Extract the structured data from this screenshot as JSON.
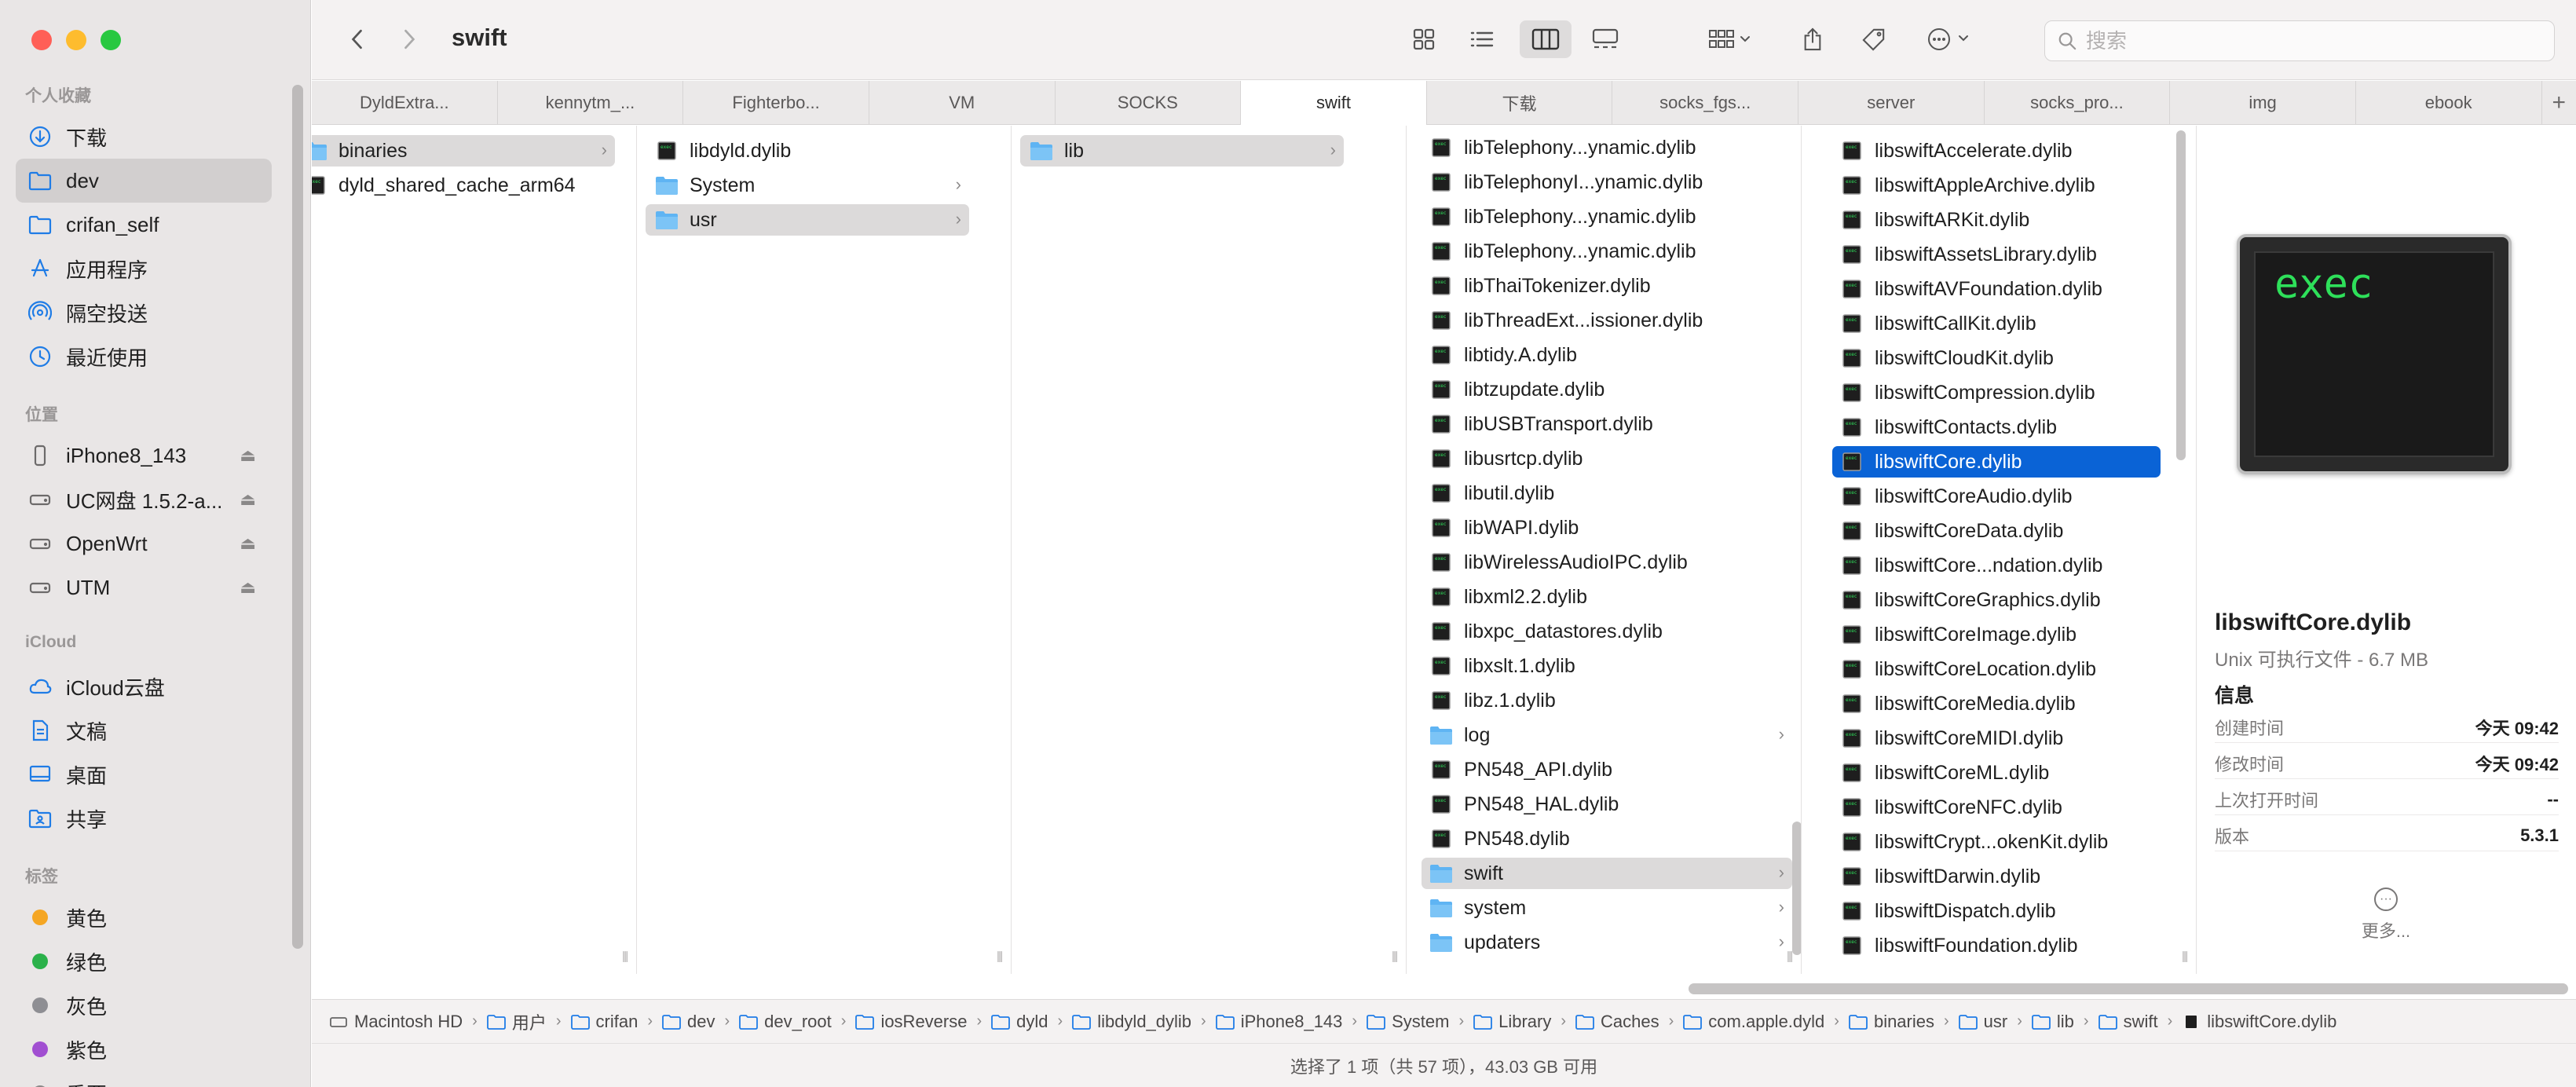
{
  "window": {
    "title": "swift"
  },
  "search": {
    "placeholder": "搜索"
  },
  "sidebar": {
    "favorites_title": "个人收藏",
    "favorites": [
      {
        "label": "下载",
        "icon": "download-icon"
      },
      {
        "label": "dev",
        "icon": "folder-icon",
        "selected": true
      },
      {
        "label": "crifan_self",
        "icon": "folder-icon"
      },
      {
        "label": "应用程序",
        "icon": "apps-icon"
      },
      {
        "label": "隔空投送",
        "icon": "airdrop-icon"
      },
      {
        "label": "最近使用",
        "icon": "clock-icon"
      }
    ],
    "locations_title": "位置",
    "locations": [
      {
        "label": "iPhone8_143",
        "icon": "iphone-icon"
      },
      {
        "label": "UC网盘 1.5.2-a...",
        "icon": "drive-icon"
      },
      {
        "label": "OpenWrt",
        "icon": "drive-icon"
      },
      {
        "label": "UTM",
        "icon": "drive-icon"
      }
    ],
    "icloud_title": "iCloud",
    "icloud": [
      {
        "label": "iCloud云盘",
        "icon": "cloud-icon"
      },
      {
        "label": "文稿",
        "icon": "document-icon"
      },
      {
        "label": "桌面",
        "icon": "desktop-icon"
      },
      {
        "label": "共享",
        "icon": "shared-folder-icon"
      }
    ],
    "tags_title": "标签",
    "tags": [
      {
        "label": "黄色",
        "color": "#f5a623"
      },
      {
        "label": "绿色",
        "color": "#2bb14a"
      },
      {
        "label": "灰色",
        "color": "#8e8e93"
      },
      {
        "label": "紫色",
        "color": "#a14fd1"
      },
      {
        "label": "重要",
        "color": "#ffffff"
      }
    ]
  },
  "tabs": [
    "DyldExtra...",
    "kennytm_...",
    "Fighterbo...",
    "VM",
    "SOCKS",
    "swift",
    "下载",
    "socks_fgs...",
    "server",
    "socks_pro...",
    "img",
    "ebook"
  ],
  "active_tab": "swift",
  "columns": {
    "col1": [
      {
        "name": "binaries",
        "type": "folder",
        "selected": "gray"
      },
      {
        "name": "dyld_shared_cache_arm64",
        "type": "exec"
      }
    ],
    "col2": [
      {
        "name": "libdyld.dylib",
        "type": "exec"
      },
      {
        "name": "System",
        "type": "folder"
      },
      {
        "name": "usr",
        "type": "folder",
        "selected": "gray"
      }
    ],
    "col3": [
      {
        "name": "lib",
        "type": "folder",
        "selected": "gray"
      }
    ],
    "col4": [
      {
        "name": "libTelephony...ynamic.dylib",
        "type": "exec"
      },
      {
        "name": "libTelephonyI...ynamic.dylib",
        "type": "exec"
      },
      {
        "name": "libTelephony...ynamic.dylib",
        "type": "exec"
      },
      {
        "name": "libTelephony...ynamic.dylib",
        "type": "exec"
      },
      {
        "name": "libThaiTokenizer.dylib",
        "type": "exec"
      },
      {
        "name": "libThreadExt...issioner.dylib",
        "type": "exec"
      },
      {
        "name": "libtidy.A.dylib",
        "type": "exec"
      },
      {
        "name": "libtzupdate.dylib",
        "type": "exec"
      },
      {
        "name": "libUSBTransport.dylib",
        "type": "exec"
      },
      {
        "name": "libusrtcp.dylib",
        "type": "exec"
      },
      {
        "name": "libutil.dylib",
        "type": "exec"
      },
      {
        "name": "libWAPI.dylib",
        "type": "exec"
      },
      {
        "name": "libWirelessAudioIPC.dylib",
        "type": "exec"
      },
      {
        "name": "libxml2.2.dylib",
        "type": "exec"
      },
      {
        "name": "libxpc_datastores.dylib",
        "type": "exec"
      },
      {
        "name": "libxslt.1.dylib",
        "type": "exec"
      },
      {
        "name": "libz.1.dylib",
        "type": "exec"
      },
      {
        "name": "log",
        "type": "folder"
      },
      {
        "name": "PN548_API.dylib",
        "type": "exec"
      },
      {
        "name": "PN548_HAL.dylib",
        "type": "exec"
      },
      {
        "name": "PN548.dylib",
        "type": "exec"
      },
      {
        "name": "swift",
        "type": "folder",
        "selected": "gray"
      },
      {
        "name": "system",
        "type": "folder"
      },
      {
        "name": "updaters",
        "type": "folder"
      }
    ],
    "col5": [
      {
        "name": "libswiftAccelerate.dylib",
        "type": "exec"
      },
      {
        "name": "libswiftAppleArchive.dylib",
        "type": "exec"
      },
      {
        "name": "libswiftARKit.dylib",
        "type": "exec"
      },
      {
        "name": "libswiftAssetsLibrary.dylib",
        "type": "exec"
      },
      {
        "name": "libswiftAVFoundation.dylib",
        "type": "exec"
      },
      {
        "name": "libswiftCallKit.dylib",
        "type": "exec"
      },
      {
        "name": "libswiftCloudKit.dylib",
        "type": "exec"
      },
      {
        "name": "libswiftCompression.dylib",
        "type": "exec"
      },
      {
        "name": "libswiftContacts.dylib",
        "type": "exec"
      },
      {
        "name": "libswiftCore.dylib",
        "type": "exec",
        "selected": "blue"
      },
      {
        "name": "libswiftCoreAudio.dylib",
        "type": "exec"
      },
      {
        "name": "libswiftCoreData.dylib",
        "type": "exec"
      },
      {
        "name": "libswiftCore...ndation.dylib",
        "type": "exec"
      },
      {
        "name": "libswiftCoreGraphics.dylib",
        "type": "exec"
      },
      {
        "name": "libswiftCoreImage.dylib",
        "type": "exec"
      },
      {
        "name": "libswiftCoreLocation.dylib",
        "type": "exec"
      },
      {
        "name": "libswiftCoreMedia.dylib",
        "type": "exec"
      },
      {
        "name": "libswiftCoreMIDI.dylib",
        "type": "exec"
      },
      {
        "name": "libswiftCoreML.dylib",
        "type": "exec"
      },
      {
        "name": "libswiftCoreNFC.dylib",
        "type": "exec"
      },
      {
        "name": "libswiftCrypt...okenKit.dylib",
        "type": "exec"
      },
      {
        "name": "libswiftDarwin.dylib",
        "type": "exec"
      },
      {
        "name": "libswiftDispatch.dylib",
        "type": "exec"
      },
      {
        "name": "libswiftFoundation.dylib",
        "type": "exec"
      }
    ]
  },
  "preview": {
    "icon_text": "exec",
    "name": "libswiftCore.dylib",
    "kind": "Unix 可执行文件 - 6.7 MB",
    "info_title": "信息",
    "rows": [
      {
        "k": "创建时间",
        "v": "今天 09:42"
      },
      {
        "k": "修改时间",
        "v": "今天 09:42"
      },
      {
        "k": "上次打开时间",
        "v": "--"
      },
      {
        "k": "版本",
        "v": "5.3.1"
      }
    ],
    "more_label": "更多..."
  },
  "path": [
    {
      "label": "Macintosh HD",
      "icon": "disk"
    },
    {
      "label": "用户",
      "icon": "folder"
    },
    {
      "label": "crifan",
      "icon": "folder"
    },
    {
      "label": "dev",
      "icon": "folder"
    },
    {
      "label": "dev_root",
      "icon": "folder"
    },
    {
      "label": "iosReverse",
      "icon": "folder"
    },
    {
      "label": "dyld",
      "icon": "folder"
    },
    {
      "label": "libdyld_dylib",
      "icon": "folder"
    },
    {
      "label": "iPhone8_143",
      "icon": "folder"
    },
    {
      "label": "System",
      "icon": "folder"
    },
    {
      "label": "Library",
      "icon": "folder"
    },
    {
      "label": "Caches",
      "icon": "folder"
    },
    {
      "label": "com.apple.dyld",
      "icon": "folder"
    },
    {
      "label": "binaries",
      "icon": "folder"
    },
    {
      "label": "usr",
      "icon": "folder"
    },
    {
      "label": "lib",
      "icon": "folder"
    },
    {
      "label": "swift",
      "icon": "folder"
    },
    {
      "label": "libswiftCore.dylib",
      "icon": "exec"
    }
  ],
  "status": "选择了 1 项（共 57 项），43.03 GB 可用",
  "colors": {
    "selection_blue": "#0a63d6",
    "folder_blue": "#5fb4f3",
    "exec_green": "#2ee05a"
  }
}
